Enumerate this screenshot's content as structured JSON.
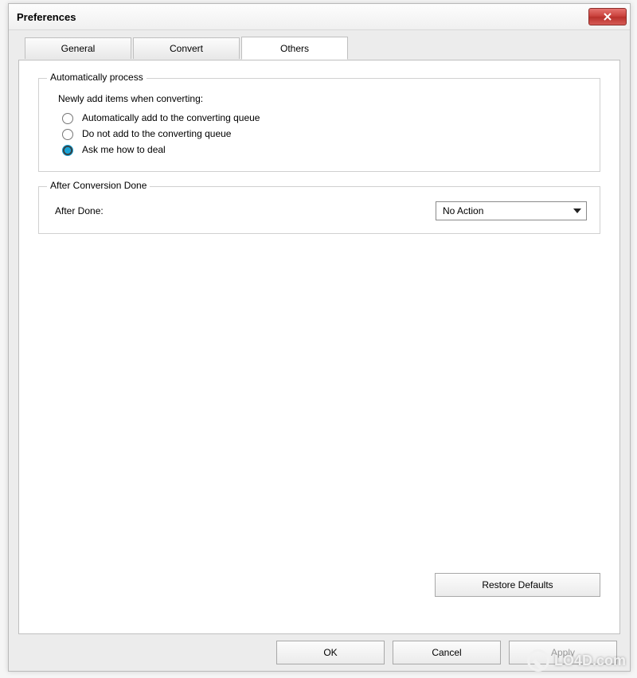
{
  "window": {
    "title": "Preferences"
  },
  "tabs": {
    "general": "General",
    "convert": "Convert",
    "others": "Others"
  },
  "auto_process": {
    "legend": "Automatically process",
    "note": "Newly add items when converting:",
    "options": {
      "add": "Automatically add to the converting queue",
      "skip": "Do not add to the converting queue",
      "ask": "Ask me how to deal"
    },
    "selected": "ask"
  },
  "after_done": {
    "legend": "After Conversion Done",
    "label": "After Done:",
    "value": "No Action"
  },
  "buttons": {
    "restore": "Restore Defaults",
    "ok": "OK",
    "cancel": "Cancel",
    "apply": "Apply"
  },
  "watermark": "LO4D.com"
}
